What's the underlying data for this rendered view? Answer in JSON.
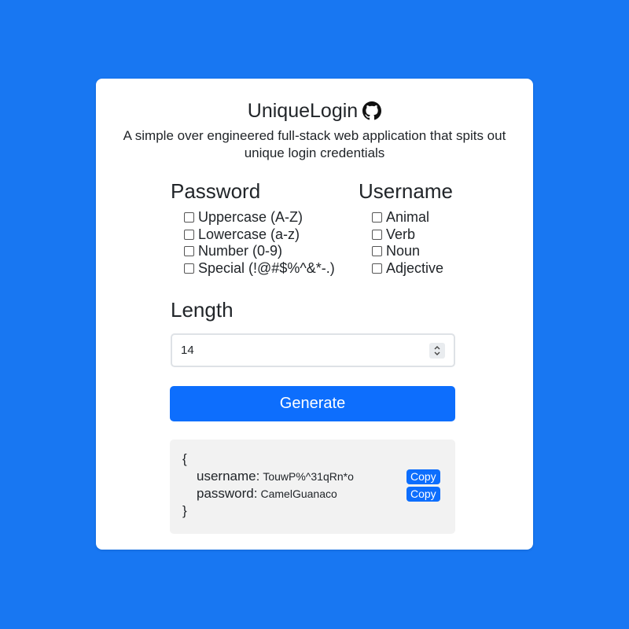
{
  "header": {
    "title": "UniqueLogin",
    "subtitle": "A simple over engineered full-stack web application that spits out unique login credentials",
    "icon": "github-icon"
  },
  "password": {
    "title": "Password",
    "options": [
      {
        "label": "Uppercase (A-Z)",
        "checked": false
      },
      {
        "label": "Lowercase (a-z)",
        "checked": false
      },
      {
        "label": "Number (0-9)",
        "checked": false
      },
      {
        "label": "Special (!@#$%^&*-.)",
        "checked": false
      }
    ]
  },
  "username": {
    "title": "Username",
    "options": [
      {
        "label": "Animal",
        "checked": false
      },
      {
        "label": "Verb",
        "checked": false
      },
      {
        "label": "Noun",
        "checked": false
      },
      {
        "label": "Adjective",
        "checked": false
      }
    ]
  },
  "length": {
    "title": "Length",
    "value": "14"
  },
  "generate": {
    "label": "Generate"
  },
  "output": {
    "open_brace": "{",
    "close_brace": "}",
    "username_key": "username:",
    "username_value": "TouwP%^31qRn*o",
    "password_key": "password:",
    "password_value": "CamelGuanaco",
    "copy_label": "Copy"
  },
  "colors": {
    "background": "#1877f2",
    "primary": "#0d6efd",
    "output_bg": "#f2f2f2"
  }
}
